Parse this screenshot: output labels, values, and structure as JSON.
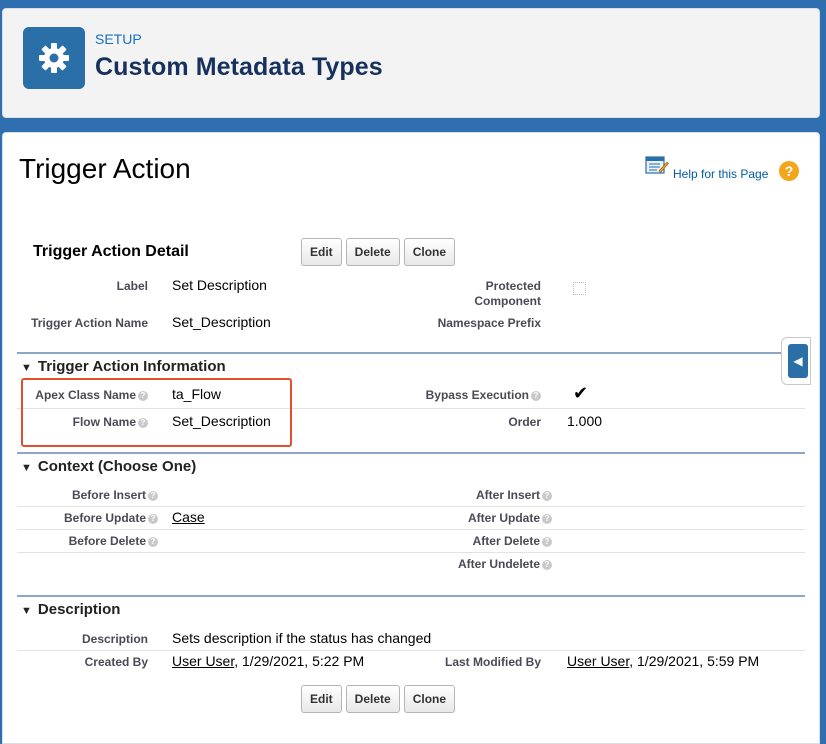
{
  "header": {
    "setup_label": "SETUP",
    "title": "Custom Metadata Types",
    "icon": "gear-icon"
  },
  "page": {
    "title": "Trigger Action",
    "help_link": "Help for this Page",
    "help_icon": "help-question-icon"
  },
  "detail": {
    "title": "Trigger Action Detail",
    "buttons": {
      "edit": "Edit",
      "delete": "Delete",
      "clone": "Clone"
    },
    "label_label": "Label",
    "label_value": "Set Description",
    "protected_label": "Protected Component",
    "protected_checked": false,
    "name_label": "Trigger Action Name",
    "name_value": "Set_Description",
    "namespace_label": "Namespace Prefix",
    "namespace_value": ""
  },
  "info_section": {
    "title": "Trigger Action Information",
    "apex_label": "Apex Class Name",
    "apex_value": "ta_Flow",
    "bypass_label": "Bypass Execution",
    "bypass_checked": true,
    "flow_label": "Flow Name",
    "flow_value": "Set_Description",
    "order_label": "Order",
    "order_value": "1.000"
  },
  "context_section": {
    "title": "Context (Choose One)",
    "before_insert_label": "Before Insert",
    "before_insert_value": "",
    "after_insert_label": "After Insert",
    "after_insert_value": "",
    "before_update_label": "Before Update",
    "before_update_value": "Case",
    "after_update_label": "After Update",
    "after_update_value": "",
    "before_delete_label": "Before Delete",
    "before_delete_value": "",
    "after_delete_label": "After Delete",
    "after_delete_value": "",
    "after_undelete_label": "After Undelete",
    "after_undelete_value": ""
  },
  "description_section": {
    "title": "Description",
    "description_label": "Description",
    "description_value": "Sets description if the status has changed",
    "created_label": "Created By",
    "created_user": "User User",
    "created_date": ", 1/29/2021, 5:22 PM",
    "modified_label": "Last Modified By",
    "modified_user": "User User",
    "modified_date": ", 1/29/2021, 5:59 PM"
  },
  "colors": {
    "accent": "#2a6fa8",
    "highlight": "#e44f2b",
    "section_rule": "#8aa7c6"
  }
}
